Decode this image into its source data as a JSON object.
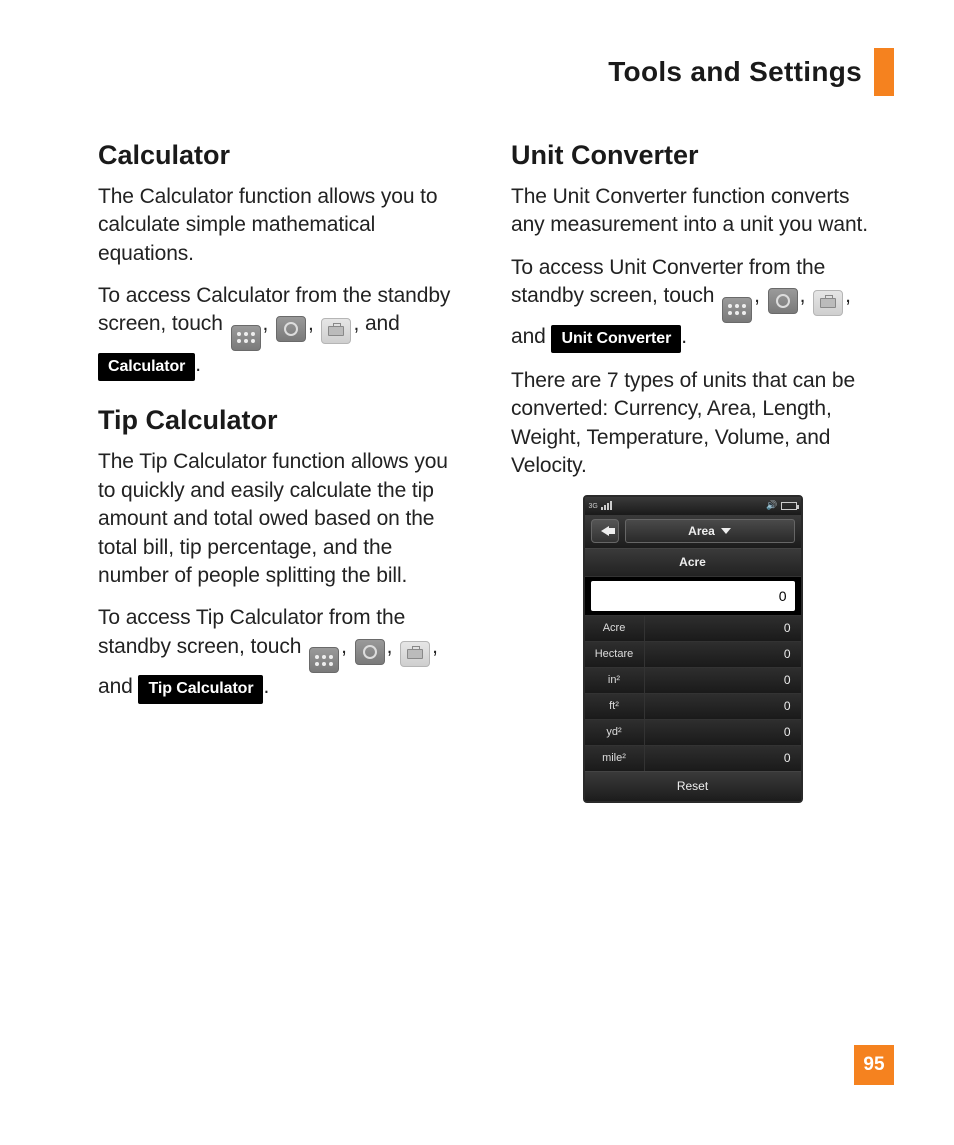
{
  "header": {
    "title": "Tools and Settings"
  },
  "page_number": "95",
  "left": {
    "calc": {
      "heading": "Calculator",
      "p1": "The Calculator function allows you to calculate simple mathematical equations.",
      "p2a": "To access Calculator from the standby screen, touch ",
      "p2b": ", ",
      "p2c": ", ",
      "p2d": ", and ",
      "badge": "Calculator",
      "p2e": "."
    },
    "tip": {
      "heading": "Tip Calculator",
      "p1": "The Tip Calculator function allows you to quickly and easily calculate the tip amount and total owed based on the total bill, tip percentage, and the number of people splitting the bill.",
      "p2a": "To access Tip Calculator from the standby screen, touch ",
      "p2b": ", ",
      "p2c": ", ",
      "p2d": ", and ",
      "badge": "Tip Calculator",
      "p2e": "."
    }
  },
  "right": {
    "unit": {
      "heading": "Unit Converter",
      "p1": "The Unit Converter function converts any measurement into a unit you want.",
      "p2a": "To access Unit Converter from the standby screen, touch ",
      "p2b": ", ",
      "p2c": ", ",
      "p2d": ", and ",
      "badge": "Unit Converter",
      "p2e": ".",
      "p3": "There are 7 types of units that can be converted: Currency, Area, Length, Weight, Temperature, Volume, and Velocity."
    }
  },
  "phone": {
    "status_net": "3G",
    "dropdown": "Area",
    "selected_unit": "Acre",
    "input_value": "0",
    "rows": [
      {
        "name": "Acre",
        "val": "0"
      },
      {
        "name": "Hectare",
        "val": "0"
      },
      {
        "name": "in²",
        "val": "0"
      },
      {
        "name": "ft²",
        "val": "0"
      },
      {
        "name": "yd²",
        "val": "0"
      },
      {
        "name": "mile²",
        "val": "0"
      }
    ],
    "reset": "Reset"
  }
}
